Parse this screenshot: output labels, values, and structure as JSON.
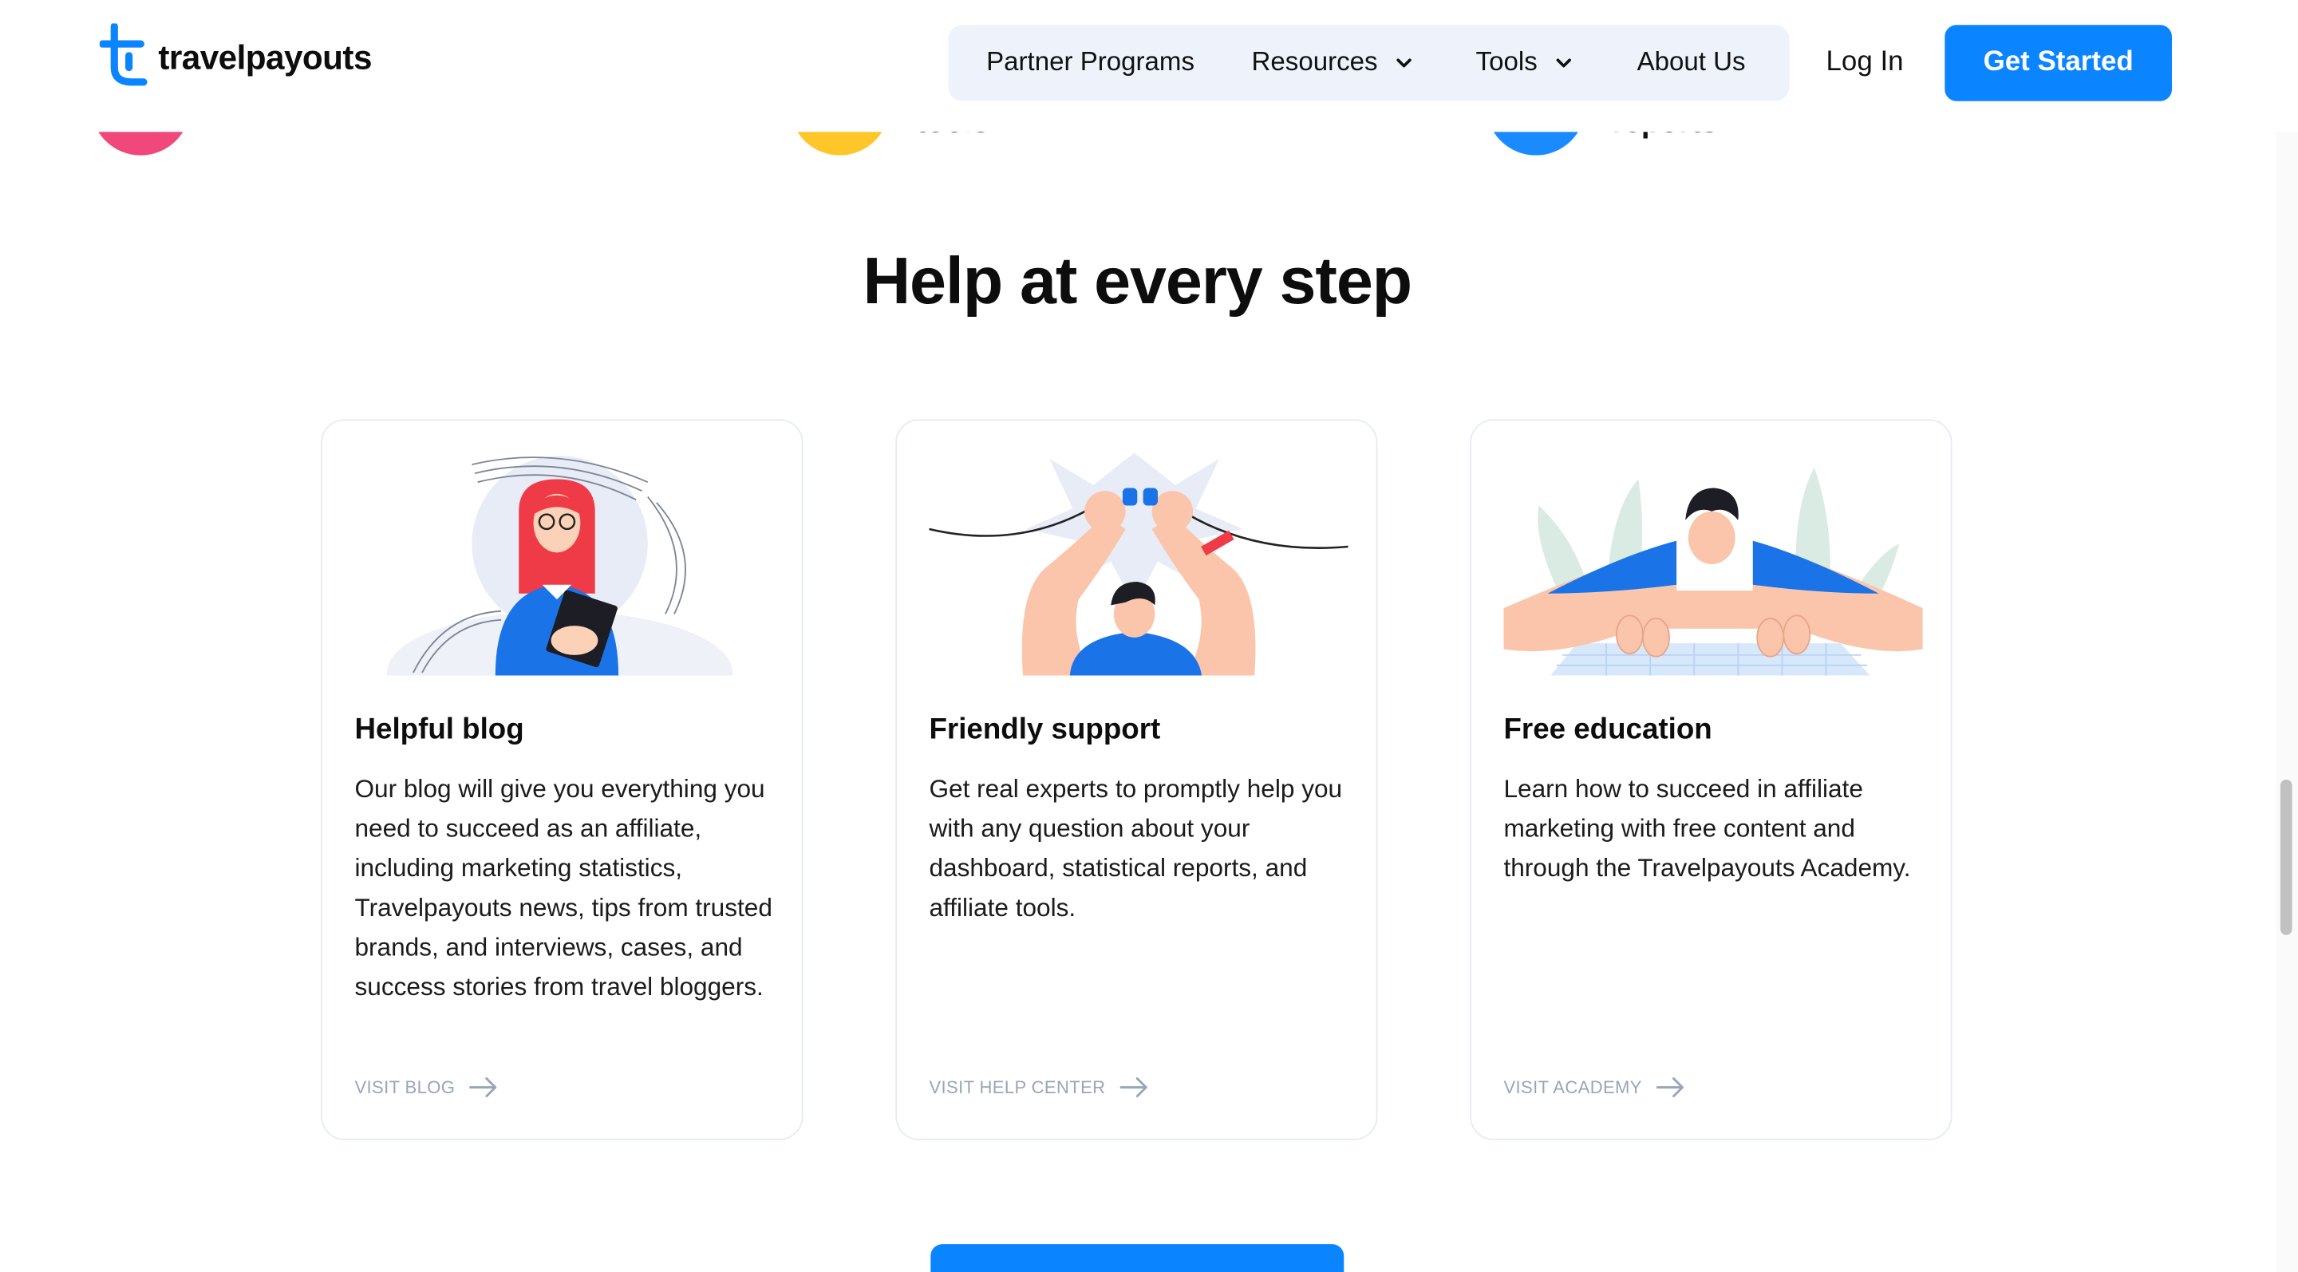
{
  "header": {
    "logo_text": "travelpayouts",
    "nav": [
      {
        "label": "Partner Programs",
        "has_dropdown": false
      },
      {
        "label": "Resources",
        "has_dropdown": true
      },
      {
        "label": "Tools",
        "has_dropdown": true
      },
      {
        "label": "About Us",
        "has_dropdown": false
      }
    ],
    "login_label": "Log In",
    "cta_label": "Get Started"
  },
  "previous_section": {
    "cut_labels": [
      "tools",
      "reports"
    ],
    "bubble_colors": [
      "#f0487a",
      "#ffc629",
      "#1a8bff"
    ]
  },
  "section": {
    "title": "Help at every step",
    "cards": [
      {
        "title": "Helpful blog",
        "text": "Our blog will give you everything you need to succeed as an affiliate, including marketing statistics, Travelpayouts news, tips from trusted brands, and interviews, cases, and success stories from travel bloggers.",
        "link": "VISIT BLOG"
      },
      {
        "title": "Friendly support",
        "text": "Get real experts to promptly help you with any question about your dashboard, statistical reports, and affiliate tools.",
        "link": "VISIT HELP CENTER"
      },
      {
        "title": "Free education",
        "text": "Learn how to succeed in affiliate marketing with free content and through the Travelpayouts Academy.",
        "link": "VISIT ACADEMY"
      }
    ]
  },
  "colors": {
    "accent": "#0a85ff",
    "nav_bg": "#eef3fb",
    "link_gray": "#98a6b9"
  }
}
